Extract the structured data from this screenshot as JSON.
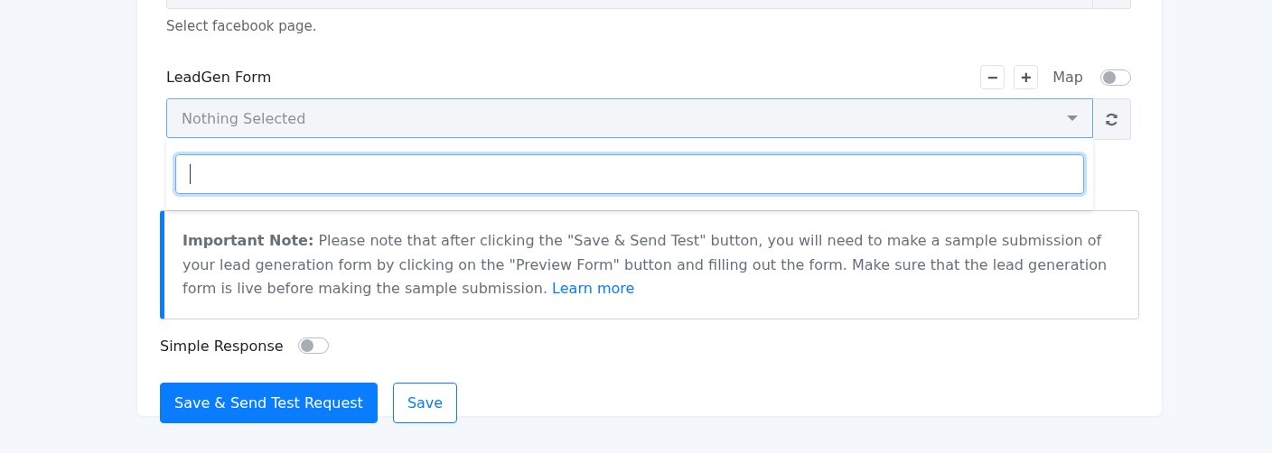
{
  "facebook_page": {
    "help": "Select facebook page."
  },
  "leadgen_form": {
    "label": "LeadGen Form",
    "buttons": [
      "−",
      "+"
    ],
    "map_label": "Map",
    "map_on": false,
    "placeholder": "Nothing Selected",
    "dropdown_open": true
  },
  "note": {
    "text": "**Important Note:** Please note that after clicking the \"Save & Send Test\" button, you will need to make a sample submission of your lead generation form by clicking on the \"Preview Form\" button and filling out the form. Make sure that the lead generation form is live before making the sample submission.",
    "link": "Learn more"
  },
  "simple_response": {
    "label": "Simple Response",
    "on": false
  },
  "actions": [
    {
      "label": "Save & Send Test Request",
      "kind": "primary"
    },
    {
      "label": "Save",
      "kind": "outline"
    }
  ]
}
